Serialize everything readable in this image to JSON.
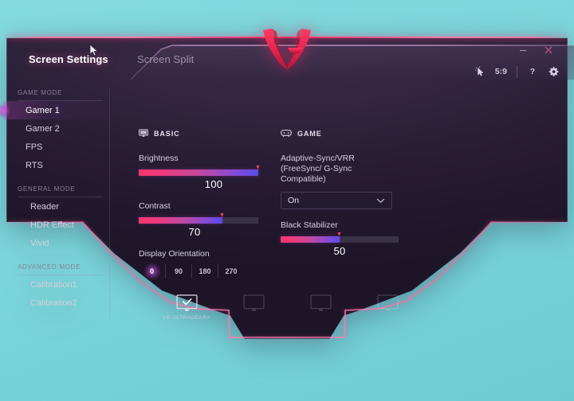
{
  "app": {
    "brand_logo": "lg-ultragear-logo",
    "background_color": "#7ed8dc",
    "window_color": "#2c2039",
    "accent_color": "#ff3c6e",
    "accent_secondary": "#b94bd4"
  },
  "window_controls": {
    "minimize": "minimize-icon",
    "close": "close-icon"
  },
  "tabs": [
    {
      "label": "Screen Settings",
      "active": true
    },
    {
      "label": "Screen Split",
      "active": false
    }
  ],
  "toolbar": {
    "items": [
      {
        "name": "pointer-highlight-icon",
        "type": "icon",
        "label": ""
      },
      {
        "name": "aspect-ratio",
        "type": "text",
        "label": "5:9"
      },
      {
        "name": "separator",
        "type": "separator",
        "label": ""
      },
      {
        "name": "help-icon",
        "type": "text",
        "label": "?"
      },
      {
        "name": "gear-icon",
        "type": "icon",
        "label": ""
      }
    ]
  },
  "sidebar": {
    "groups": [
      {
        "label": "GAME MODE",
        "items": [
          {
            "label": "Gamer 1",
            "selected": true
          },
          {
            "label": "Gamer 2",
            "selected": false
          },
          {
            "label": "FPS",
            "selected": false
          },
          {
            "label": "RTS",
            "selected": false
          }
        ]
      },
      {
        "label": "GENERAL MODE",
        "items": [
          {
            "label": "Reader",
            "selected": false
          },
          {
            "label": "HDR Effect",
            "selected": false
          },
          {
            "label": "Vivid",
            "selected": false
          }
        ]
      },
      {
        "label": "ADVANCED MODE",
        "items": [
          {
            "label": "Calibration1",
            "selected": false
          },
          {
            "label": "Calibration2",
            "selected": false
          }
        ]
      }
    ]
  },
  "basic_panel": {
    "title": "BASIC",
    "icon": "monitor-icon",
    "brightness": {
      "label": "Brightness",
      "value": "100",
      "percent": 100
    },
    "contrast": {
      "label": "Contrast",
      "value": "70",
      "percent": 70
    },
    "display_orientation": {
      "label": "Display Orientation",
      "options": [
        {
          "label": "0",
          "selected": true
        },
        {
          "label": "90",
          "selected": false
        },
        {
          "label": "180",
          "selected": false
        },
        {
          "label": "270",
          "selected": false
        }
      ]
    }
  },
  "game_panel": {
    "title": "GAME",
    "icon": "gamepad-icon",
    "adaptive_sync": {
      "label_line1": "Adaptive-Sync/VRR",
      "label_line2": "(FreeSync/ G-Sync Compatible)",
      "value": "On"
    },
    "black_stabilizer": {
      "label": "Black Stabilizer",
      "value": "50",
      "percent": 50
    }
  },
  "device_bar": {
    "devices": [
      {
        "label": "LG ULTRAGEAR+",
        "selected": true
      },
      {
        "label": "",
        "selected": false
      },
      {
        "label": "",
        "selected": false
      },
      {
        "label": "",
        "selected": false
      }
    ]
  }
}
